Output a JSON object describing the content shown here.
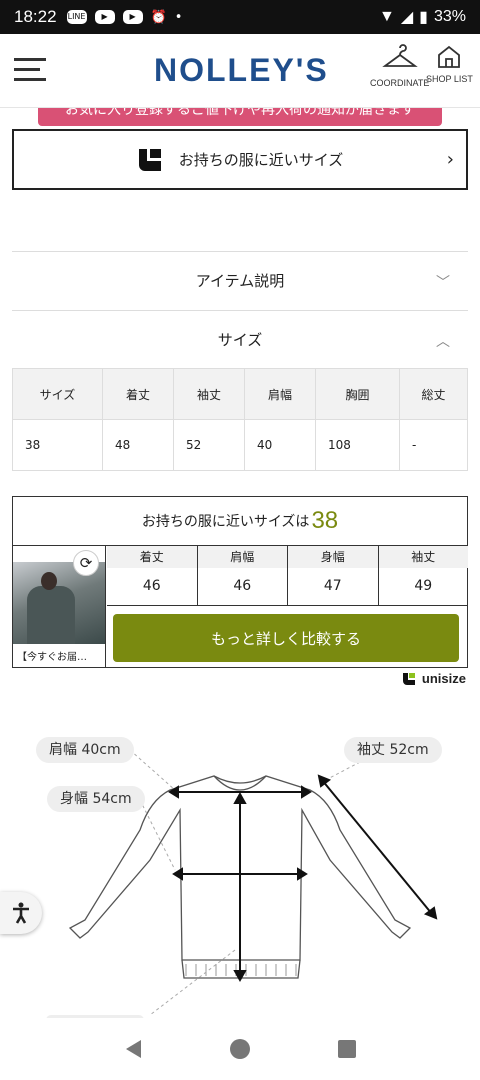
{
  "status_bar": {
    "time": "18:22",
    "battery": "33%"
  },
  "header": {
    "logo": "NOLLEY'S",
    "coordinate_label": "COORDINATE",
    "shoplist_label": "SHOP LIST"
  },
  "banner": {
    "text": "お気に入り登録するご値下げや再入荷の通知が届きます"
  },
  "size_finder": {
    "label": "お持ちの服に近いサイズ"
  },
  "accordion": {
    "item_desc": "アイテム説明",
    "size": "サイズ"
  },
  "size_table": {
    "headers": [
      "サイズ",
      "着丈",
      "袖丈",
      "肩幅",
      "胸囲",
      "総丈"
    ],
    "row": [
      "38",
      "48",
      "52",
      "40",
      "108",
      "-"
    ]
  },
  "compare": {
    "title": "お持ちの服に近いサイズは",
    "size": "38",
    "item_caption": "【今すぐお届…",
    "measures": [
      {
        "label": "着丈",
        "value": "46"
      },
      {
        "label": "肩幅",
        "value": "46"
      },
      {
        "label": "身幅",
        "value": "47"
      },
      {
        "label": "袖丈",
        "value": "49"
      }
    ],
    "button": "もっと詳しく比較する"
  },
  "unisize": {
    "label": "unisize"
  },
  "diagram": {
    "shoulder": "肩幅 40cm",
    "sleeve": "袖丈 52cm",
    "body_width": "身幅 54cm"
  }
}
